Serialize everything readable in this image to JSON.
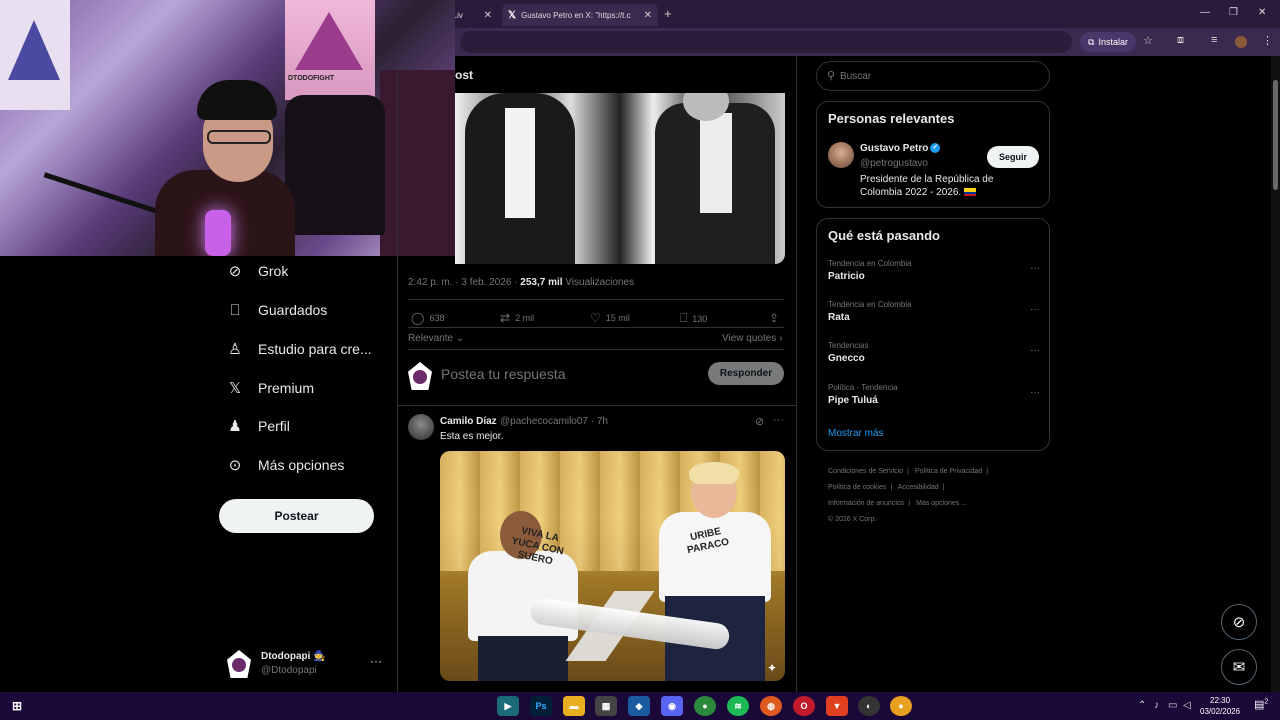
{
  "browser": {
    "tabs": [
      {
        "label": "h Liv"
      },
      {
        "label": "Gustavo Petro en X: \"https://t.c"
      }
    ],
    "install_label": "Instalar"
  },
  "webcam": {
    "stamp_text": "DTODOFIGHT"
  },
  "nav": {
    "items": [
      {
        "label": "Grok",
        "icon": "grok-icon"
      },
      {
        "label": "Guardados",
        "icon": "bookmark-icon"
      },
      {
        "label": "Estudio para cre...",
        "icon": "creator-studio-icon"
      },
      {
        "label": "Premium",
        "icon": "x-premium-icon"
      },
      {
        "label": "Perfil",
        "icon": "profile-icon"
      },
      {
        "label": "Más opciones",
        "icon": "more-options-icon"
      }
    ],
    "post_button": "Postear",
    "account": {
      "name": "Dtodopapi 🧙",
      "handle": "@Dtodopapi"
    }
  },
  "post": {
    "header": "ost",
    "meta_time": "2:42 p. m. · 3 feb. 2026 · ",
    "views_count": "253,7 mil",
    "views_label": " Visualizaciones",
    "actions": {
      "replies": "638",
      "reposts": "2 mil",
      "likes": "15 mil",
      "bookmarks": "130"
    },
    "sort_label": "Relevante",
    "view_quotes": "View quotes",
    "reply_placeholder": "Postea tu respuesta",
    "reply_button": "Responder"
  },
  "reply_tweet": {
    "name": "Camilo Díaz",
    "handle": "@pachecocamilo07 · 7h",
    "text": "Esta es mejor.",
    "shirt_left": "VIVA LA YUCA CON SUERO",
    "shirt_right": "URIBE PARACO"
  },
  "sidebar": {
    "search_placeholder": "Buscar",
    "relevant_title": "Personas relevantes",
    "relevant_person": {
      "name": "Gustavo Petro",
      "handle": "@petrogustavo",
      "bio": "Presidente de la República de Colombia 2022 - 2026.",
      "follow_label": "Seguir"
    },
    "trends_title": "Qué está pasando",
    "trends": [
      {
        "context": "Tendencia en Colombia",
        "name": "Patricio"
      },
      {
        "context": "Tendencia en Colombia",
        "name": "Rata"
      },
      {
        "context": "Tendencias",
        "name": "Gnecco"
      },
      {
        "context": "Política · Tendencia",
        "name": "Pipe Tuluá"
      }
    ],
    "show_more": "Mostrar más",
    "footer": [
      "Condiciones de Servicio",
      "|",
      "Política de Privacidad",
      "|",
      "Política de cookies",
      "|",
      "Accesibilidad",
      "|",
      "Información de anuncios",
      "|",
      "Más opciones ...",
      "© 2026 X Corp."
    ]
  },
  "taskbar": {
    "time": "22:30",
    "date": "03/02/2026",
    "notifications": "2"
  }
}
